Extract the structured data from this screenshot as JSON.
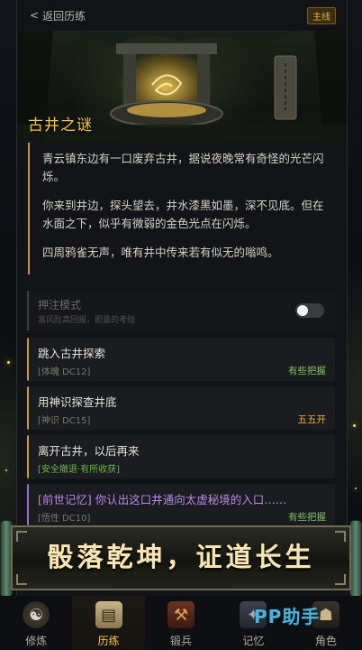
{
  "topbar": {
    "back_label": "返回历练",
    "badge": "主线"
  },
  "hero": {
    "title": "古井之谜"
  },
  "story": {
    "paragraphs": [
      "青云镇东边有一口废弃古井，据说夜晚常有奇怪的光芒闪烁。",
      "你来到井边，探头望去，井水漆黑如墨，深不见底。但在水面之下，似乎有微弱的金色光点在闪烁。",
      "四周鸦雀无声，唯有井中传来若有似无的嗡鸣。"
    ]
  },
  "toggle": {
    "title": "押注模式",
    "subtitle": "富风险高回报，胆量的考验",
    "enabled": false
  },
  "options": [
    {
      "title": "跳入古井探索",
      "sub": "[体魄 DC12]",
      "right": "有些把握",
      "right_color": "#7fc35a"
    },
    {
      "title": "用神识探查井底",
      "sub": "[神识 DC15]",
      "right": "五五开",
      "right_color": "#e0b24a"
    },
    {
      "title": "离开古井，以后再来",
      "sub": "[安全撤退·有所收获]",
      "right": "",
      "sub_color": "#6fb34a"
    },
    {
      "title": "[前世记忆] 你认出这口井通向太虚秘境的入口……",
      "sub": "[悟性 DC10]",
      "right": "有些把握",
      "right_color": "#7fc35a",
      "title_color": "#b98ae6"
    }
  ],
  "banner": {
    "text": "骰落乾坤，证道长生"
  },
  "nav": [
    {
      "label": "修炼",
      "icon": "cultivate-icon",
      "active": false
    },
    {
      "label": "历练",
      "icon": "scroll-map-icon",
      "active": true
    },
    {
      "label": "锻兵",
      "icon": "forge-icon",
      "active": false
    },
    {
      "label": "记忆",
      "icon": "memory-icon",
      "active": false
    },
    {
      "label": "角色",
      "icon": "character-icon",
      "active": false
    }
  ],
  "watermark": "PP助手",
  "colors": {
    "accent": "#f0c54d",
    "gold_border": "#c59a3a",
    "success": "#7fc35a",
    "purple": "#b98ae6"
  }
}
